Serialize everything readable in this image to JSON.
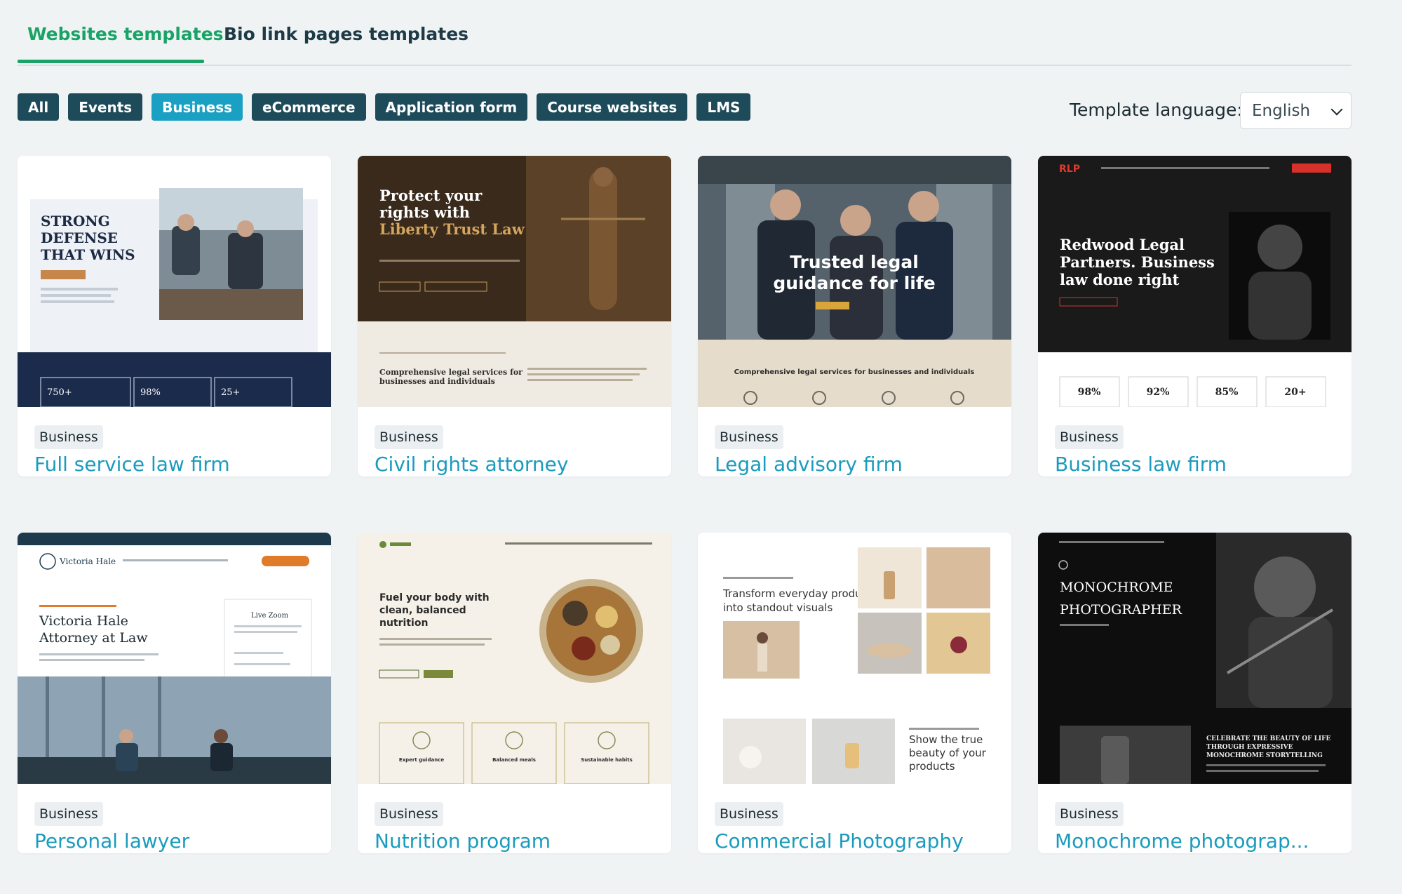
{
  "tabs": [
    {
      "label": "Websites templates",
      "active": true
    },
    {
      "label": "Bio link pages templates",
      "active": false
    }
  ],
  "filters": [
    {
      "label": "All",
      "active": false
    },
    {
      "label": "Events",
      "active": false
    },
    {
      "label": "Business",
      "active": true
    },
    {
      "label": "eCommerce",
      "active": false
    },
    {
      "label": "Application form",
      "active": false
    },
    {
      "label": "Course websites",
      "active": false
    },
    {
      "label": "LMS",
      "active": false
    }
  ],
  "language": {
    "label": "Template language:",
    "value": "English"
  },
  "colors": {
    "accent": "#1aa367",
    "chip": "#1e4b5a",
    "chip_active": "#1aa0c2",
    "title": "#1a9bbd"
  },
  "cards": [
    {
      "category": "Business",
      "title": "Full service law firm",
      "preview": {
        "headline": [
          "STRONG",
          "DEFENSE",
          "THAT WINS"
        ],
        "stats": [
          "750+",
          "98%",
          "25+"
        ]
      }
    },
    {
      "category": "Business",
      "title": "Civil rights attorney",
      "preview": {
        "headline": [
          "Protect your",
          "rights with",
          "Liberty Trust Law"
        ],
        "sub": [
          "Comprehensive legal services for",
          "businesses and individuals"
        ]
      }
    },
    {
      "category": "Business",
      "title": "Legal advisory firm",
      "preview": {
        "headline": [
          "Trusted legal",
          "guidance for life"
        ],
        "sub": "Comprehensive legal services for businesses and individuals"
      }
    },
    {
      "category": "Business",
      "title": "Business law firm",
      "preview": {
        "logo": "RLP",
        "headline": [
          "Redwood Legal",
          "Partners. Business",
          "law done right"
        ],
        "stats": [
          "98%",
          "92%",
          "85%",
          "20+"
        ]
      }
    },
    {
      "category": "Business",
      "title": "Personal lawyer",
      "preview": {
        "logo": "Victoria Hale",
        "headline": [
          "Victoria Hale",
          "Attorney at Law"
        ],
        "aside": "Live Zoom"
      }
    },
    {
      "category": "Business",
      "title": "Nutrition program",
      "preview": {
        "headline": [
          "Fuel your body with",
          "clean, balanced",
          "nutrition"
        ],
        "features": [
          "Expert guidance",
          "Balanced meals",
          "Sustainable habits"
        ]
      }
    },
    {
      "category": "Business",
      "title": "Commercial Photography",
      "preview": {
        "headline": [
          "Transform everyday products",
          "into standout visuals"
        ],
        "sub": [
          "Show the true",
          "beauty of your",
          "products"
        ]
      }
    },
    {
      "category": "Business",
      "title": "Monochrome photograp...",
      "preview": {
        "headline": [
          "MONOCHROME",
          "PHOTOGRAPHER"
        ],
        "sub": [
          "CELEBRATE THE BEAUTY OF LIFE",
          "THROUGH EXPRESSIVE",
          "MONOCHROME STORYTELLING"
        ]
      }
    }
  ]
}
